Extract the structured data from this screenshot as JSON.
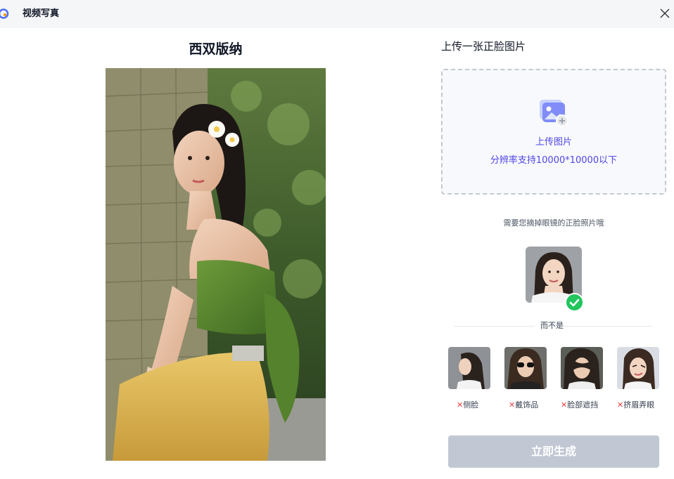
{
  "window": {
    "title": "视频写真"
  },
  "template": {
    "title": "西双版纳"
  },
  "upload": {
    "heading": "上传一张正脸图片",
    "button_label": "上传图片",
    "resolution_hint": "分辨率支持10000*10000以下"
  },
  "guidance": {
    "glasses_hint": "需要您摘掉眼镜的正脸照片哦",
    "divider_text": "而不是",
    "bad_examples": [
      {
        "mark": "✕",
        "label": "侧脸"
      },
      {
        "mark": "✕",
        "label": "戴饰品"
      },
      {
        "mark": "✕",
        "label": "脸部遮挡"
      },
      {
        "mark": "✕",
        "label": "挤眉弄眼"
      }
    ]
  },
  "actions": {
    "generate_label": "立即生成"
  },
  "colors": {
    "accent": "#4f46e5",
    "success": "#22c55e",
    "error": "#ef4444",
    "disabled_button": "#c2c8d3"
  },
  "icons": {
    "app": "app-logo-icon",
    "close": "close-icon",
    "upload": "image-upload-icon",
    "check": "check-icon"
  }
}
